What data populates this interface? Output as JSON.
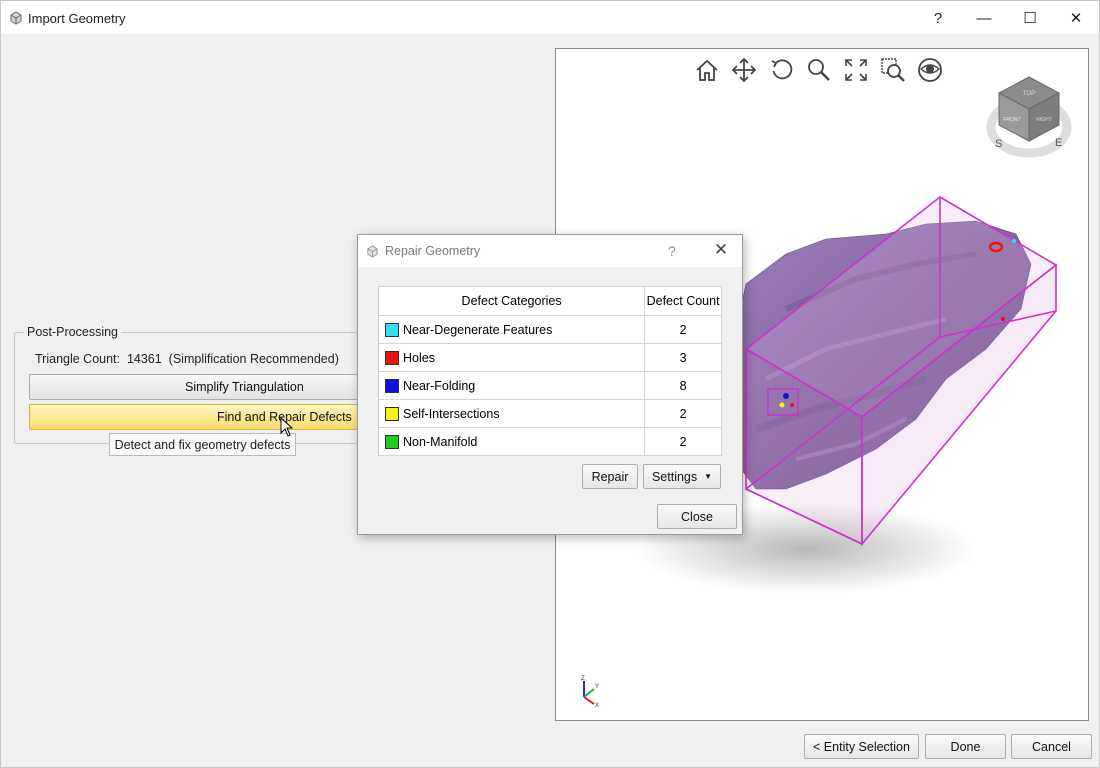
{
  "window": {
    "title": "Import Geometry",
    "help": "?",
    "minimize": "—",
    "maximize": "☐",
    "close": "✕"
  },
  "post_processing": {
    "group_label": "Post-Processing",
    "triangle_count_label": "Triangle Count:",
    "triangle_count_value": "14361",
    "triangle_count_note": "(Simplification Recommended)",
    "simplify_button": "Simplify Triangulation",
    "find_repair_button": "Find and Repair Defects",
    "tooltip": "Detect and fix geometry defects"
  },
  "viewport": {
    "toolbar": [
      "home-icon",
      "pan-icon",
      "rotate-icon",
      "zoom-icon",
      "fit-all-icon",
      "zoom-window-icon",
      "view-style-icon"
    ],
    "navcube": {
      "top": "TOP",
      "front": "FRONT",
      "right": "RIGHT",
      "south": "S",
      "east": "E"
    },
    "axes": {
      "z": "Z",
      "y": "Y",
      "x": "X"
    },
    "colors": {
      "mesh": "#8a6aa6",
      "bbox": "#cc33cc"
    }
  },
  "repair_dialog": {
    "title": "Repair Geometry",
    "help": "?",
    "close": "✕",
    "columns": [
      "Defect Categories",
      "Defect Count"
    ],
    "rows": [
      {
        "name": "Near-Degenerate Features",
        "count": "2",
        "color": "#33e0ee"
      },
      {
        "name": "Holes",
        "count": "3",
        "color": "#ee1111"
      },
      {
        "name": "Near-Folding",
        "count": "8",
        "color": "#1111dd"
      },
      {
        "name": "Self-Intersections",
        "count": "2",
        "color": "#f5f50a"
      },
      {
        "name": "Non-Manifold",
        "count": "2",
        "color": "#22cc22"
      }
    ],
    "repair_button": "Repair",
    "settings_button": "Settings",
    "close_button": "Close"
  },
  "footer": {
    "back_button": "< Entity Selection",
    "done_button": "Done",
    "cancel_button": "Cancel"
  }
}
